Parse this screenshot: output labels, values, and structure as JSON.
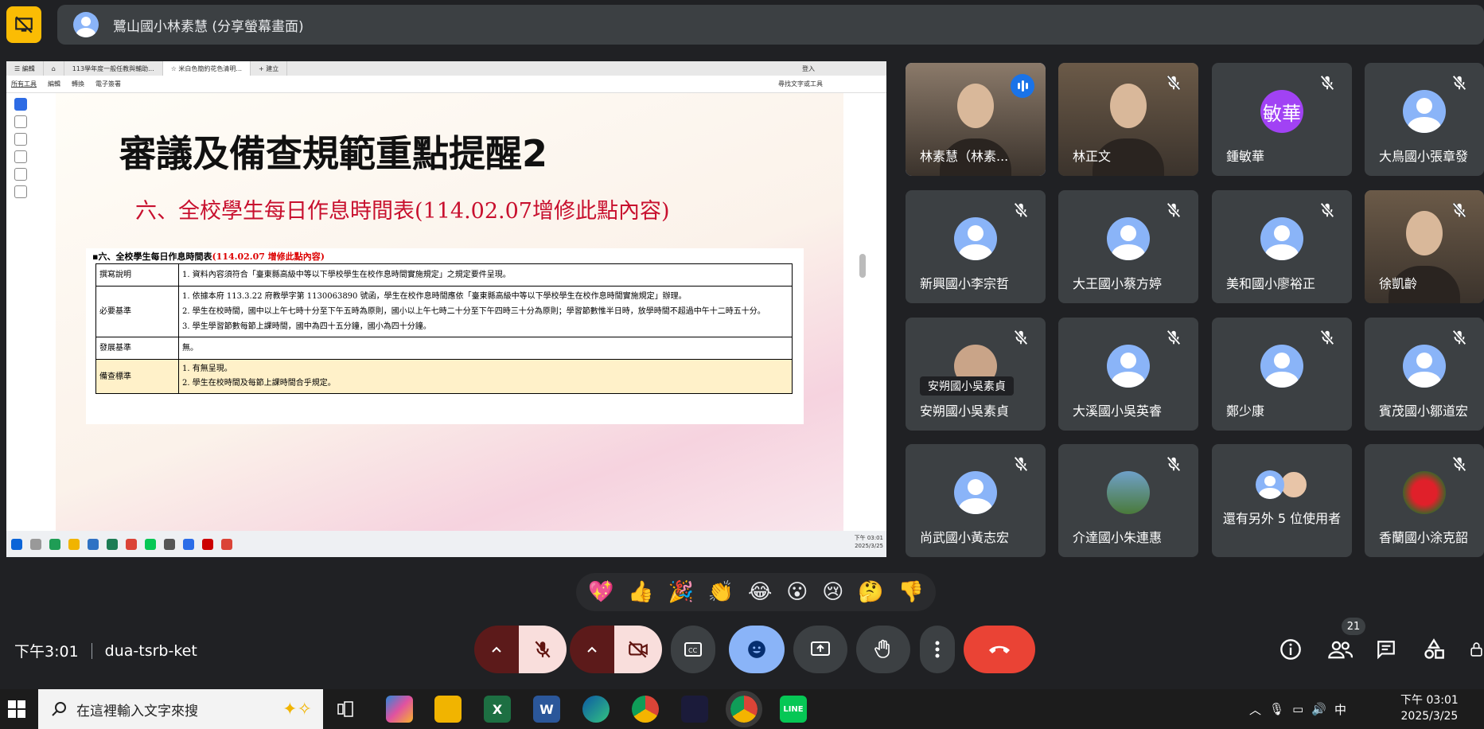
{
  "presenter": {
    "name": "鷺山國小林素慧 (分享螢幕畫面)"
  },
  "shared_screen": {
    "tabs": [
      "☰ 編輯",
      "⌂",
      "113學年度一般任教與輔助...",
      "☆ 米白色簡約花色清明...",
      "+ 建立"
    ],
    "top_right": "登入",
    "tools": [
      "所有工具",
      "編輯",
      "轉換",
      "電子簽署"
    ],
    "tools_right": "尋找文字或工具",
    "slide_title": "審議及備查規範重點提醒2",
    "slide_subtitle": "六、全校學生每日作息時間表(114.02.07增修此點內容)",
    "table_heading": "▪六、全校學生每日作息時間表",
    "table_heading_red": "(114.02.07 增修此點內容)",
    "rows": [
      {
        "key": "撰寫說明",
        "lines": [
          "1. 資料內容須符合「臺東縣高級中等以下學校學生在校作息時間實施規定」之規定要件呈現。"
        ]
      },
      {
        "key": "必要基準",
        "lines": [
          "1. 依據本府 113.3.22 府教學字第 1130063890 號函，學生在校作息時間應依「臺東縣高級中等以下學校學生在校作息時間實施規定」辦理。",
          "2. 學生在校時間，國中以上午七時十分至下午五時為原則，國小以上午七時二十分至下午四時三十分為原則；學習節數惟半日時，放學時間不超過中午十二時五十分。",
          "3. 學生學習節數每節上課時間，國中為四十五分鐘，國小為四十分鐘。"
        ]
      },
      {
        "key": "發展基準",
        "lines": [
          "無。"
        ]
      },
      {
        "key": "備查標準",
        "lines": [
          "1. 有無呈現。",
          "2. 學生在校時間及每節上課時間合乎規定。"
        ]
      }
    ],
    "clock": "下午 03:01",
    "date": "2025/3/25"
  },
  "participants": [
    {
      "name": "林素慧（林素...",
      "type": "photo",
      "speaking": true
    },
    {
      "name": "林正文",
      "type": "photo"
    },
    {
      "name": "鍾敏華",
      "type": "letter",
      "letter": "敏華"
    },
    {
      "name": "大鳥國小張章發",
      "type": "avatar"
    },
    {
      "name": "新興國小李宗哲",
      "type": "avatar"
    },
    {
      "name": "大王國小蔡方婷",
      "type": "avatar"
    },
    {
      "name": "美和國小廖裕正",
      "type": "avatar"
    },
    {
      "name": "徐凱齡",
      "type": "photo"
    },
    {
      "name": "安朔國小吳素貞",
      "type": "photo-small",
      "hover": "安朔國小吳素貞"
    },
    {
      "name": "大溪國小吳英睿",
      "type": "avatar"
    },
    {
      "name": "鄭少康",
      "type": "avatar"
    },
    {
      "name": "賓茂國小鄒道宏",
      "type": "avatar"
    },
    {
      "name": "尚武國小黃志宏",
      "type": "avatar"
    },
    {
      "name": "介達國小朱連惠",
      "type": "pic"
    },
    {
      "name": "還有另外 5 位使用者",
      "type": "more"
    },
    {
      "name": "香蘭國小涂克韶",
      "type": "pic-red"
    }
  ],
  "reactions": [
    "💖",
    "👍",
    "🎉",
    "👏",
    "😂",
    "😮",
    "😢",
    "🤔",
    "👎"
  ],
  "meeting": {
    "time": "下午3:01",
    "code": "dua-tsrb-ket",
    "participant_count": "21"
  },
  "taskbar": {
    "search_placeholder": "在這裡輸入文字來搜",
    "ime": "中",
    "clock": "下午 03:01",
    "date": "2025/3/25"
  },
  "colors": {
    "accent": "#8ab4f8",
    "end_call": "#ea4335",
    "present_yellow": "#fbbc04"
  }
}
